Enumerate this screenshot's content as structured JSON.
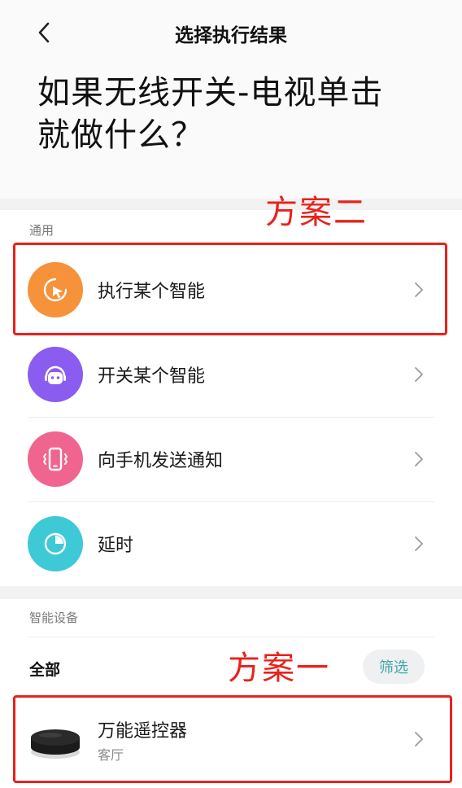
{
  "header": {
    "title": "选择执行结果",
    "question_line1": "如果无线开关-电视单击",
    "question_line2": "就做什么？"
  },
  "general": {
    "section_label": "通用",
    "items": [
      {
        "label": "执行某个智能",
        "icon": "cursor-click-icon",
        "color": "#f5923a"
      },
      {
        "label": "开关某个智能",
        "icon": "robot-icon",
        "color": "#8b5cf0"
      },
      {
        "label": "向手机发送通知",
        "icon": "phone-vibrate-icon",
        "color": "#f0658f"
      },
      {
        "label": "延时",
        "icon": "timer-icon",
        "color": "#3ec9d6"
      }
    ]
  },
  "devices": {
    "section_label": "智能设备",
    "all_label": "全部",
    "filter_label": "筛选",
    "items": [
      {
        "name": "万能遥控器",
        "room": "客厅",
        "icon": "ir-remote-puck-icon"
      }
    ]
  },
  "annotations": {
    "plan_two": "方案二",
    "plan_one": "方案一",
    "color": "#e8221b"
  }
}
